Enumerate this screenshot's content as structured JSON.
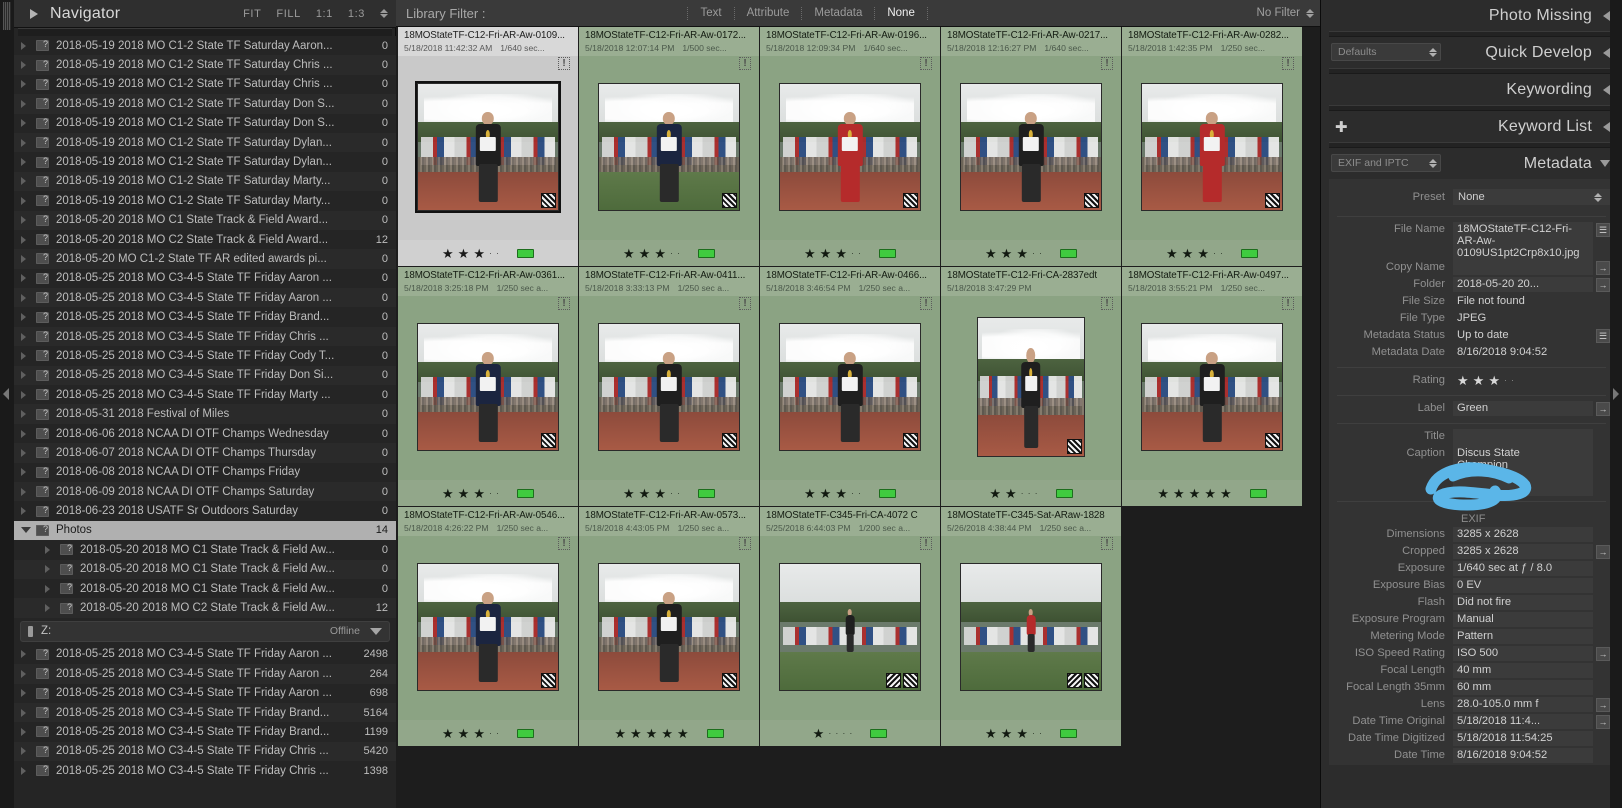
{
  "navigator": {
    "title": "Navigator",
    "zoom_modes": [
      "FIT",
      "FILL",
      "1:1",
      "1:3"
    ]
  },
  "folders": [
    {
      "name": "2018-05-19 2018 MO C1-2 State TF Saturday Aaron...",
      "count": "0",
      "indent": 0
    },
    {
      "name": "2018-05-19 2018 MO C1-2 State TF Saturday Chris ...",
      "count": "0",
      "indent": 0
    },
    {
      "name": "2018-05-19 2018 MO C1-2 State TF Saturday Chris ...",
      "count": "0",
      "indent": 0
    },
    {
      "name": "2018-05-19 2018 MO C1-2 State TF Saturday Don S...",
      "count": "0",
      "indent": 0
    },
    {
      "name": "2018-05-19 2018 MO C1-2 State TF Saturday Don S...",
      "count": "0",
      "indent": 0
    },
    {
      "name": "2018-05-19 2018 MO C1-2 State TF Saturday Dylan...",
      "count": "0",
      "indent": 0
    },
    {
      "name": "2018-05-19 2018 MO C1-2 State TF Saturday Dylan...",
      "count": "0",
      "indent": 0
    },
    {
      "name": "2018-05-19 2018 MO C1-2 State TF Saturday Marty...",
      "count": "0",
      "indent": 0
    },
    {
      "name": "2018-05-19 2018 MO C1-2 State TF Saturday Marty...",
      "count": "0",
      "indent": 0
    },
    {
      "name": "2018-05-20 2018 MO C1 State Track & Field Award...",
      "count": "0",
      "indent": 0
    },
    {
      "name": "2018-05-20 2018 MO C2 State Track & Field Award...",
      "count": "12",
      "indent": 0
    },
    {
      "name": "2018-05-20 MO C1-2 State TF AR edited awards pi...",
      "count": "0",
      "indent": 0
    },
    {
      "name": "2018-05-25 2018 MO C3-4-5 State TF Friday Aaron ...",
      "count": "0",
      "indent": 0
    },
    {
      "name": "2018-05-25 2018 MO C3-4-5 State TF Friday Aaron ...",
      "count": "0",
      "indent": 0
    },
    {
      "name": "2018-05-25 2018 MO C3-4-5 State TF Friday Brand...",
      "count": "0",
      "indent": 0
    },
    {
      "name": "2018-05-25 2018 MO C3-4-5 State TF Friday Chris ...",
      "count": "0",
      "indent": 0
    },
    {
      "name": "2018-05-25 2018 MO C3-4-5 State TF Friday Cody T...",
      "count": "0",
      "indent": 0
    },
    {
      "name": "2018-05-25 2018 MO C3-4-5 State TF Friday Don Si...",
      "count": "0",
      "indent": 0
    },
    {
      "name": "2018-05-25 2018 MO C3-4-5 State TF Friday Marty ...",
      "count": "0",
      "indent": 0
    },
    {
      "name": "2018-05-31 2018 Festival of Miles",
      "count": "0",
      "indent": 0
    },
    {
      "name": "2018-06-06 2018 NCAA DI OTF Champs Wednesday",
      "count": "0",
      "indent": 0
    },
    {
      "name": "2018-06-07 2018 NCAA DI OTF Champs Thursday",
      "count": "0",
      "indent": 0
    },
    {
      "name": "2018-06-08 2018 NCAA DI OTF Champs Friday",
      "count": "0",
      "indent": 0
    },
    {
      "name": "2018-06-09 2018 NCAA DI OTF Champs Saturday",
      "count": "0",
      "indent": 0
    },
    {
      "name": "2018-06-23 2018 USATF Sr Outdoors Saturday",
      "count": "0",
      "indent": 0
    },
    {
      "name": "Photos",
      "count": "14",
      "indent": 0,
      "selected": true,
      "expanded": true
    },
    {
      "name": "2018-05-20 2018 MO C1 State Track & Field Aw...",
      "count": "0",
      "indent": 1
    },
    {
      "name": "2018-05-20 2018 MO C1 State Track & Field Aw...",
      "count": "0",
      "indent": 1
    },
    {
      "name": "2018-05-20 2018 MO C1 State Track & Field Aw...",
      "count": "0",
      "indent": 1
    },
    {
      "name": "2018-05-20 2018 MO C2 State Track & Field Aw...",
      "count": "12",
      "indent": 1
    }
  ],
  "volume": {
    "name": "Z:",
    "status": "Offline"
  },
  "folders_offline": [
    {
      "name": "2018-05-25 2018 MO C3-4-5 State TF Friday Aaron ...",
      "count": "2498"
    },
    {
      "name": "2018-05-25 2018 MO C3-4-5 State TF Friday Aaron ...",
      "count": "264"
    },
    {
      "name": "2018-05-25 2018 MO C3-4-5 State TF Friday Aaron ...",
      "count": "698"
    },
    {
      "name": "2018-05-25 2018 MO C3-4-5 State TF Friday Brand...",
      "count": "5164"
    },
    {
      "name": "2018-05-25 2018 MO C3-4-5 State TF Friday Brand...",
      "count": "1199"
    },
    {
      "name": "2018-05-25 2018 MO C3-4-5 State TF Friday Chris ...",
      "count": "5420"
    },
    {
      "name": "2018-05-25 2018 MO C3-4-5 State TF Friday Chris ...",
      "count": "1398"
    }
  ],
  "library_filter": {
    "label": "Library Filter :",
    "tabs": [
      {
        "label": "Text",
        "active": false
      },
      {
        "label": "Attribute",
        "active": false
      },
      {
        "label": "Metadata",
        "active": false
      },
      {
        "label": "None",
        "active": true
      }
    ],
    "no_filter": "No Filter"
  },
  "grid": {
    "cells": [
      {
        "title": "18MOStateTF-C12-Fri-AR-Aw-0109...",
        "date": "5/18/2018 11:42:32 AM",
        "shutter": "1/640 sec...",
        "stars": 3,
        "label_color": "#3fcb3f",
        "state": "selected",
        "warn": true,
        "edit_badge": true,
        "scene": {
          "bg": "track",
          "jersey": "dark",
          "shorts": "dark",
          "medal": true
        }
      },
      {
        "title": "18MOStateTF-C12-Fri-AR-Aw-0172...",
        "date": "5/18/2018 12:07:14 PM",
        "shutter": "1/500 sec...",
        "stars": 3,
        "label_color": "#3fcb3f",
        "state": "green",
        "warn": true,
        "edit_badge": true,
        "scene": {
          "bg": "field",
          "jersey": "navy",
          "shorts": "navy",
          "medal": true
        }
      },
      {
        "title": "18MOStateTF-C12-Fri-AR-Aw-0196...",
        "date": "5/18/2018 12:09:34 PM",
        "shutter": "1/640 sec...",
        "stars": 3,
        "label_color": "#3fcb3f",
        "state": "green",
        "warn": true,
        "edit_badge": true,
        "scene": {
          "bg": "track",
          "jersey": "red",
          "shorts": "red",
          "medal": true
        }
      },
      {
        "title": "18MOStateTF-C12-Fri-AR-Aw-0217...",
        "date": "5/18/2018 12:16:27 PM",
        "shutter": "1/640 sec...",
        "stars": 3,
        "label_color": "#3fcb3f",
        "state": "green",
        "warn": true,
        "edit_badge": true,
        "scene": {
          "bg": "track",
          "jersey": "dark",
          "shorts": "dark",
          "medal": true
        }
      },
      {
        "title": "18MOStateTF-C12-Fri-AR-Aw-0282...",
        "date": "5/18/2018 1:42:35 PM",
        "shutter": "1/250 sec...",
        "stars": 3,
        "label_color": "#3fcb3f",
        "state": "green",
        "warn": true,
        "edit_badge": true,
        "scene": {
          "bg": "track",
          "jersey": "red",
          "shorts": "red",
          "medal": true
        }
      },
      {
        "title": "18MOStateTF-C12-Fri-AR-Aw-0361...",
        "date": "5/18/2018 3:25:18 PM",
        "shutter": "1/250 sec a...",
        "stars": 3,
        "label_color": "#3fcb3f",
        "state": "green",
        "warn": true,
        "edit_badge": true,
        "scene": {
          "bg": "track",
          "jersey": "navy",
          "shorts": "dark",
          "medal": true
        }
      },
      {
        "title": "18MOStateTF-C12-Fri-AR-Aw-0411...",
        "date": "5/18/2018 3:33:13 PM",
        "shutter": "1/250 sec a...",
        "stars": 3,
        "label_color": "#3fcb3f",
        "state": "green",
        "warn": true,
        "edit_badge": true,
        "scene": {
          "bg": "track",
          "jersey": "dark",
          "shorts": "dark",
          "medal": true
        }
      },
      {
        "title": "18MOStateTF-C12-Fri-AR-Aw-0466...",
        "date": "5/18/2018 3:46:54 PM",
        "shutter": "1/250 sec a...",
        "stars": 3,
        "label_color": "#3fcb3f",
        "state": "green",
        "warn": true,
        "edit_badge": true,
        "scene": {
          "bg": "track",
          "jersey": "dark",
          "shorts": "dark",
          "medal": true
        }
      },
      {
        "title": "18MOStateTF-C12-Fri-CA-2837edt",
        "date": "5/18/2018 3:47:29 PM",
        "shutter": "",
        "stars": 2,
        "label_color": "#3fcb3f",
        "state": "green",
        "warn": true,
        "edit_badge": true,
        "scene": {
          "bg": "track",
          "jersey": "dark",
          "shorts": "dark",
          "medal": true,
          "tall": true
        }
      },
      {
        "title": "18MOStateTF-C12-Fri-AR-Aw-0497...",
        "date": "5/18/2018 3:55:21 PM",
        "shutter": "1/250 sec...",
        "stars": 5,
        "label_color": "#3fcb3f",
        "state": "green",
        "warn": true,
        "edit_badge": true,
        "scene": {
          "bg": "track",
          "jersey": "dark",
          "shorts": "dark",
          "medal": true
        }
      },
      {
        "title": "18MOStateTF-C12-Fri-AR-Aw-0546...",
        "date": "5/18/2018 4:26:22 PM",
        "shutter": "1/250 sec a...",
        "stars": 3,
        "label_color": "#3fcb3f",
        "state": "green",
        "warn": true,
        "edit_badge": true,
        "scene": {
          "bg": "track",
          "jersey": "navy",
          "shorts": "dark",
          "medal": true
        }
      },
      {
        "title": "18MOStateTF-C12-Fri-AR-Aw-0573...",
        "date": "5/18/2018 4:43:05 PM",
        "shutter": "1/250 sec a...",
        "stars": 5,
        "label_color": "#3fcb3f",
        "state": "green",
        "warn": true,
        "edit_badge": true,
        "scene": {
          "bg": "track",
          "jersey": "dark",
          "shorts": "dark",
          "medal": true
        }
      },
      {
        "title": "18MOStateTF-C345-Fri-CA-4072    C",
        "date": "5/25/2018 6:44:03 PM",
        "shutter": "1/200 sec a...",
        "stars": 1,
        "label_color": "#3fcb3f",
        "state": "green",
        "warn": true,
        "edit_badge": true,
        "edit_badge2": true,
        "scene": {
          "bg": "wide",
          "jersey": "dark",
          "shorts": "dark",
          "medal": false
        }
      },
      {
        "title": "18MOStateTF-C345-Sat-ARaw-1828",
        "date": "5/26/2018 4:38:44 PM",
        "shutter": "1/250 sec a...",
        "stars": 3,
        "label_color": "#3fcb3f",
        "state": "green",
        "warn": true,
        "edit_badge": true,
        "edit_badge2": true,
        "scene": {
          "bg": "wide",
          "jersey": "red",
          "shorts": "dark",
          "medal": false
        }
      }
    ]
  },
  "right_panel": {
    "sections": [
      {
        "title": "Photo Missing",
        "collapsed": true
      },
      {
        "title": "Quick Develop",
        "collapsed": true,
        "preset": "Defaults"
      },
      {
        "title": "Keywording",
        "collapsed": true
      },
      {
        "title": "Keyword List",
        "collapsed": true
      },
      {
        "title": "Metadata",
        "collapsed": false,
        "preset": "EXIF and IPTC"
      }
    ],
    "metadata": {
      "preset_label": "Preset",
      "preset_value": "None",
      "fields": [
        {
          "label": "File Name",
          "value": "18MOStateTF-C12-Fri-AR-Aw-0109US1pt2Crp8x10.jpg",
          "btn": "list"
        },
        {
          "label": "Copy Name",
          "value": "",
          "btn": "arrow"
        },
        {
          "label": "Folder",
          "value": "2018-05-20 20...",
          "btn": "arrow"
        },
        {
          "label": "File Size",
          "value": "File not found",
          "btn": "none",
          "plain": true
        },
        {
          "label": "File Type",
          "value": "JPEG",
          "btn": "none",
          "plain": true
        },
        {
          "label": "Metadata Status",
          "value": "Up to date",
          "btn": "list",
          "plain": true
        },
        {
          "label": "Metadata Date",
          "value": "8/16/2018 9:04:52",
          "btn": "none",
          "plain": true
        }
      ],
      "rating_label": "Rating",
      "rating": 3,
      "label_field": {
        "label": "Label",
        "value": "Green",
        "btn": "arrow"
      },
      "title_field": {
        "label": "Title",
        "value": ""
      },
      "caption_field": {
        "label": "Caption",
        "value": "Discus State\nChampion",
        "redacted": true
      },
      "exif_header": "EXIF",
      "exif": [
        {
          "label": "Dimensions",
          "value": "3285 x 2628",
          "btn": "none"
        },
        {
          "label": "Cropped",
          "value": "3285 x 2628",
          "btn": "arrow"
        },
        {
          "label": "Exposure",
          "value": "1/640 sec at ƒ / 8.0",
          "btn": "none"
        },
        {
          "label": "Exposure Bias",
          "value": "0 EV",
          "btn": "none"
        },
        {
          "label": "Flash",
          "value": "Did not fire",
          "btn": "none"
        },
        {
          "label": "Exposure Program",
          "value": "Manual",
          "btn": "none"
        },
        {
          "label": "Metering Mode",
          "value": "Pattern",
          "btn": "none"
        },
        {
          "label": "ISO Speed Rating",
          "value": "ISO 500",
          "btn": "arrow"
        },
        {
          "label": "Focal Length",
          "value": "40 mm",
          "btn": "none"
        },
        {
          "label": "Focal Length 35mm",
          "value": "60 mm",
          "btn": "none"
        },
        {
          "label": "Lens",
          "value": "28.0-105.0 mm f",
          "btn": "arrow"
        },
        {
          "label": "Date Time Original",
          "value": "5/18/2018 11:4...",
          "btn": "arrow"
        },
        {
          "label": "Date Time Digitized",
          "value": "5/18/2018 11:54:25",
          "btn": "none"
        },
        {
          "label": "Date Time",
          "value": "8/16/2018 9:04:52",
          "btn": "none"
        }
      ]
    }
  },
  "colors": {
    "accent_green": "#3fcb3f",
    "cell_green": "#8ba383",
    "cell_selected": "#c9c9c9",
    "panel_bg": "#2c2c2c",
    "scribble": "#5bb6e8"
  }
}
